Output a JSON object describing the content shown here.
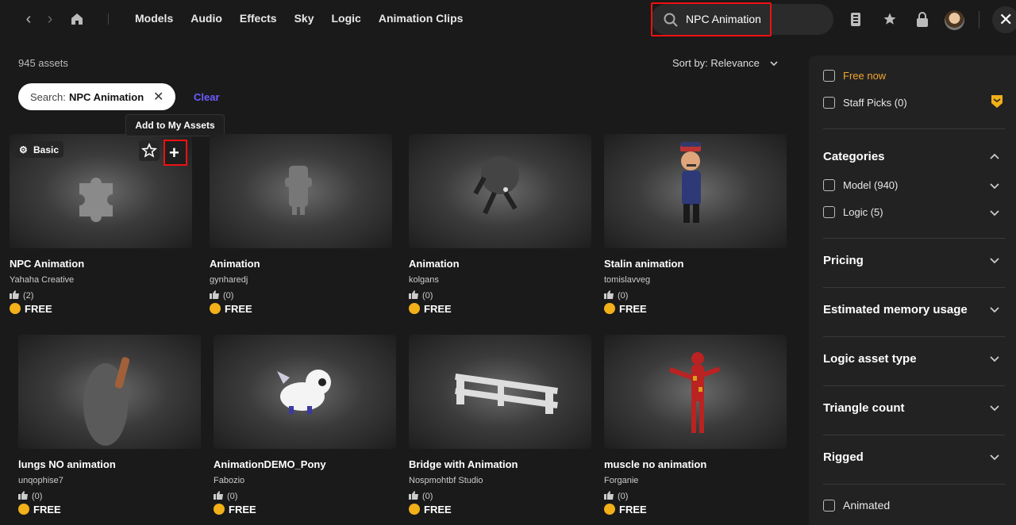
{
  "nav": {
    "menu": [
      "Models",
      "Audio",
      "Effects",
      "Sky",
      "Logic",
      "Animation Clips"
    ],
    "search_value": "NPC Animation"
  },
  "results": {
    "count": "945 assets",
    "sort": "Sort by: Relevance",
    "chip_label": "Search:",
    "chip_value": "NPC Animation",
    "clear": "Clear",
    "tooltip": "Add to My Assets",
    "badge": "Basic"
  },
  "assets": [
    {
      "title": "NPC Animation",
      "author": "Yahaha Creative",
      "likes": "(2)",
      "price": "FREE"
    },
    {
      "title": "Animation",
      "author": "gynharedj",
      "likes": "(0)",
      "price": "FREE"
    },
    {
      "title": "Animation",
      "author": "kolgans",
      "likes": "(0)",
      "price": "FREE"
    },
    {
      "title": "Stalin animation",
      "author": "tomislavveg",
      "likes": "(0)",
      "price": "FREE"
    },
    {
      "title": "lungs NO animation",
      "author": "unqophise7",
      "likes": "(0)",
      "price": "FREE"
    },
    {
      "title": "AnimationDEMO_Pony",
      "author": "Fabozio",
      "likes": "(0)",
      "price": "FREE"
    },
    {
      "title": "Bridge with Animation",
      "author": "Nospmohtbf Studio",
      "likes": "(0)",
      "price": "FREE"
    },
    {
      "title": "muscle no animation",
      "author": "Forganie",
      "likes": "(0)",
      "price": "FREE"
    }
  ],
  "filters": {
    "free_now": "Free now",
    "staff_picks": "Staff Picks (0)",
    "categories": "Categories",
    "model": "Model (940)",
    "logic": "Logic (5)",
    "pricing": "Pricing",
    "memory": "Estimated memory usage",
    "logic_type": "Logic asset type",
    "triangles": "Triangle count",
    "rigged": "Rigged",
    "animated": "Animated"
  },
  "colors": {
    "accent": "#6a5cff",
    "highlight": "#ee1111",
    "free_now": "#f2a531",
    "coin": "#f2b019"
  }
}
